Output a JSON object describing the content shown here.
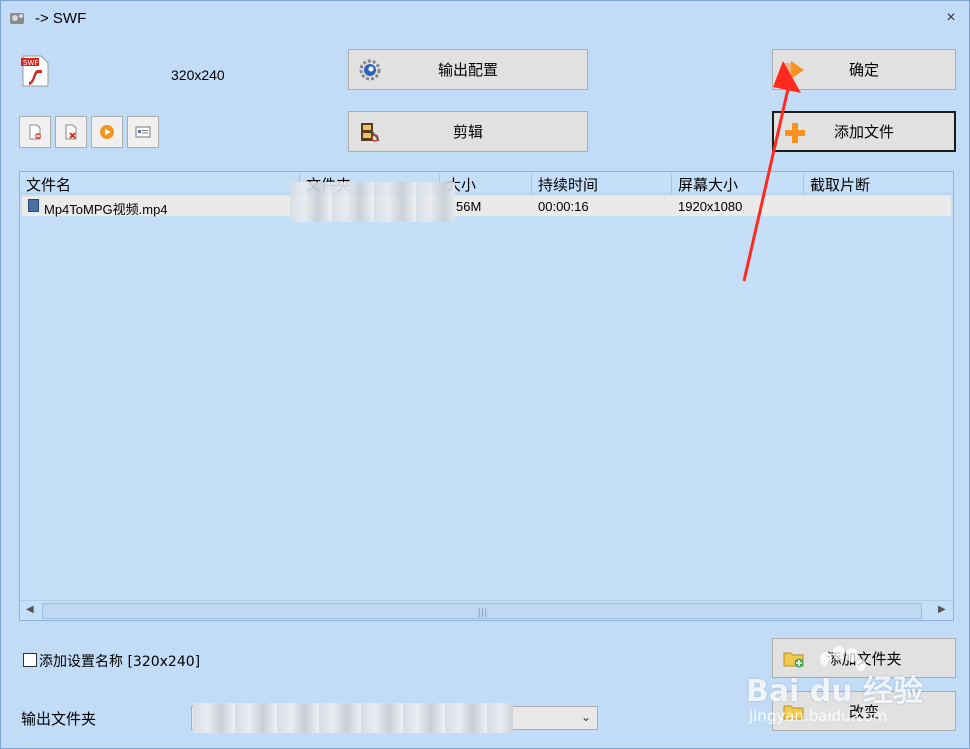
{
  "window": {
    "title": "-> SWF",
    "close_glyph": "×"
  },
  "profile": {
    "resolution": "320x240",
    "logo_text": "SWF"
  },
  "buttons": {
    "output_config": "输出配置",
    "clip": "剪辑",
    "confirm": "确定",
    "add_file": "添加文件",
    "add_folder": "添加文件夹",
    "change": "改变"
  },
  "toolbar": {
    "icons": [
      "remove-file-icon",
      "delete-file-icon",
      "play-icon",
      "info-icon"
    ]
  },
  "table": {
    "headers": [
      "文件名",
      "文件夹",
      "大小",
      "持续时间",
      "屏幕大小",
      "截取片断"
    ],
    "rows": [
      {
        "name": "Mp4ToMPG视频.mp4",
        "folder": "",
        "size": "56M",
        "duration": "00:00:16",
        "screen": "1920x1080",
        "clip": ""
      }
    ]
  },
  "options": {
    "add_setting_name": "添加设置名称 [320x240]",
    "add_setting_checked": false
  },
  "output": {
    "label": "输出文件夹",
    "value": ""
  },
  "watermark": {
    "main": "Bai du 经验",
    "sub": "jingyan.baidu.com"
  },
  "colors": {
    "background": "#c2dcf7",
    "annotation_arrow": "#ff2a1f",
    "accent_orange": "#f7931e"
  }
}
